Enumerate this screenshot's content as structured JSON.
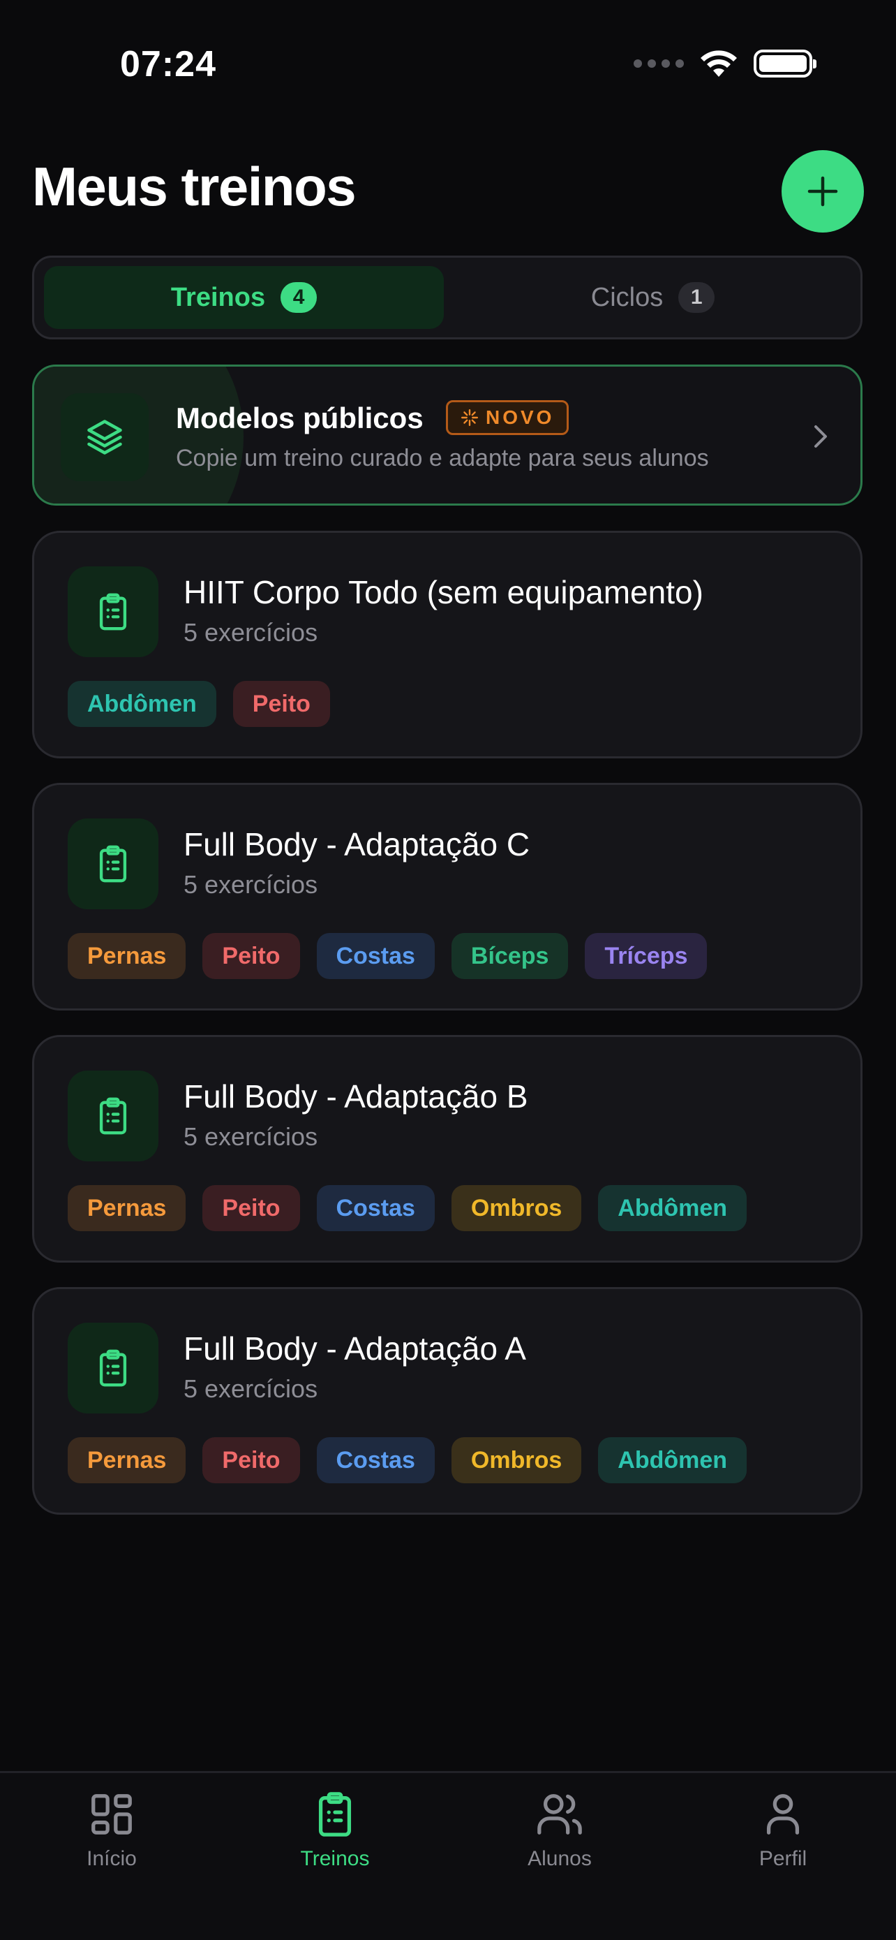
{
  "status_bar": {
    "time": "07:24"
  },
  "header": {
    "title": "Meus treinos",
    "add_icon": "plus-icon"
  },
  "segmented": {
    "tabs": [
      {
        "label": "Treinos",
        "count": "4"
      },
      {
        "label": "Ciclos",
        "count": "1"
      }
    ]
  },
  "banner": {
    "title": "Modelos públicos",
    "badge": "NOVO",
    "subtitle": "Copie um treino curado e adapte para seus alunos",
    "icon": "layers-icon"
  },
  "workouts": [
    {
      "title": "HIIT Corpo Todo (sem equipamento)",
      "subtitle": "5 exercícios",
      "tags": [
        "Abdômen",
        "Peito"
      ]
    },
    {
      "title": "Full Body - Adaptação C",
      "subtitle": "5 exercícios",
      "tags": [
        "Pernas",
        "Peito",
        "Costas",
        "Bíceps",
        "Tríceps"
      ]
    },
    {
      "title": "Full Body - Adaptação B",
      "subtitle": "5 exercícios",
      "tags": [
        "Pernas",
        "Peito",
        "Costas",
        "Ombros",
        "Abdômen"
      ]
    },
    {
      "title": "Full Body - Adaptação A",
      "subtitle": "5 exercícios",
      "tags": [
        "Pernas",
        "Peito",
        "Costas",
        "Ombros",
        "Abdômen"
      ]
    }
  ],
  "tag_colors": {
    "Abdômen": {
      "bg": "#163330",
      "fg": "#2ec4b0"
    },
    "Peito": {
      "bg": "#3a1e22",
      "fg": "#f06a6a"
    },
    "Pernas": {
      "bg": "#3a2a1e",
      "fg": "#f59a3c"
    },
    "Costas": {
      "bg": "#1e2a40",
      "fg": "#5b9cf0"
    },
    "Bíceps": {
      "bg": "#163327",
      "fg": "#34c48a"
    },
    "Tríceps": {
      "bg": "#2a2440",
      "fg": "#9a84f0"
    },
    "Ombros": {
      "bg": "#3a301a",
      "fg": "#f0b82a"
    }
  },
  "tabbar": {
    "items": [
      {
        "label": "Início",
        "icon": "grid-icon"
      },
      {
        "label": "Treinos",
        "icon": "clipboard-icon"
      },
      {
        "label": "Alunos",
        "icon": "users-icon"
      },
      {
        "label": "Perfil",
        "icon": "user-icon"
      }
    ]
  },
  "colors": {
    "accent": "#3ddc84",
    "background": "#0a0a0c",
    "card": "#151519"
  }
}
